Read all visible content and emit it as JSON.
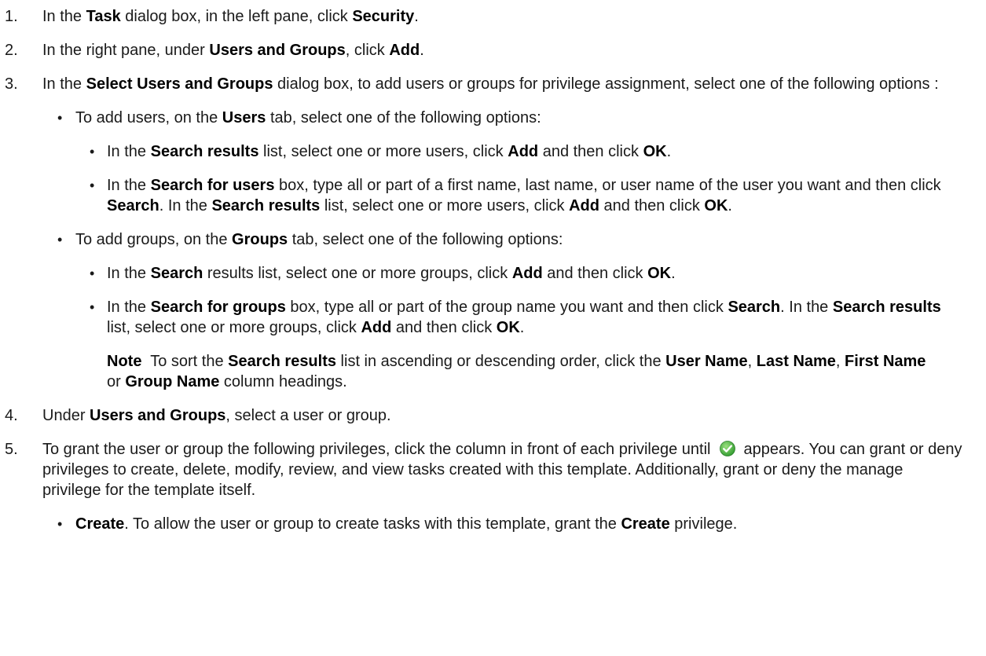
{
  "steps": [
    {
      "num": "1.",
      "parts": [
        "In the ",
        "Task",
        " dialog box, in the left pane, click ",
        "Security",
        "."
      ]
    },
    {
      "num": "2.",
      "parts": [
        "In the right pane, under ",
        "Users and Groups",
        ", click ",
        "Add",
        "."
      ]
    },
    {
      "num": "3.",
      "parts": [
        "In the ",
        "Select Users and Groups",
        " dialog box, to add users or groups for privilege assignment, select one of the following options :"
      ]
    },
    {
      "num": "4.",
      "parts": [
        "Under ",
        "Users and Groups",
        ", select a user or group."
      ]
    },
    {
      "num": "5.",
      "parts": [
        "To grant the user or group the following privileges, click the column in front of each privilege until",
        "appears. You can grant or deny privileges to create, delete, modify, review, and view tasks created with this template. Additionally, grant or deny the manage privilege for the template itself."
      ]
    }
  ],
  "users": {
    "intro": [
      "To add users, on the ",
      "Users",
      " tab, select one of the following options:"
    ],
    "opt1": [
      "In the ",
      "Search results",
      " list, select one or more users, click ",
      "Add",
      " and then click ",
      "OK",
      "."
    ],
    "opt2": [
      "In the ",
      "Search for users",
      " box, type all or part of a first name, last name, or user name of the user you want and then click ",
      "Search",
      ". In the ",
      "Search results",
      " list, select one or more users, click ",
      "Add",
      " and then click ",
      "OK",
      "."
    ]
  },
  "groups": {
    "intro": [
      "To add groups, on the ",
      "Groups",
      " tab, select one of the following options:"
    ],
    "opt1": [
      "In the ",
      "Search",
      " results list, select one or more groups, click ",
      "Add",
      " and then click ",
      "OK",
      "."
    ],
    "opt2": [
      "In the ",
      "Search for groups",
      " box, type all or part of the group name you want and then click ",
      "Search",
      ". In the ",
      "Search results",
      " list, select one or more groups, click ",
      "Add",
      " and then click ",
      "OK",
      "."
    ]
  },
  "note": [
    "Note",
    "  To sort the ",
    "Search results",
    " list in ascending or descending order, click the ",
    "User Name",
    ", ",
    "Last Name",
    ", ",
    "First Name",
    " or ",
    "Group Name",
    " column headings."
  ],
  "privileges": {
    "create": [
      "Create",
      ". To allow the user or group to create tasks with this template, grant the ",
      "Create",
      " privilege."
    ]
  },
  "bullet_glyph": "•",
  "icons": {
    "granted": "check-icon",
    "color": "#4caf50"
  }
}
